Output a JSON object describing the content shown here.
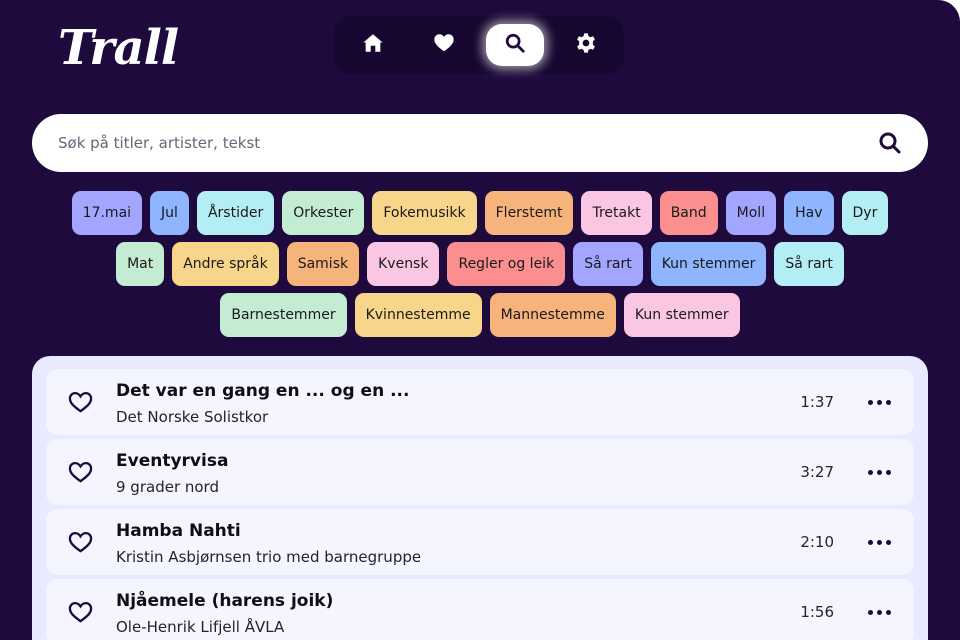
{
  "app": {
    "logo": "Trall"
  },
  "nav": {
    "items": [
      {
        "name": "home",
        "icon": "home-icon",
        "active": false
      },
      {
        "name": "favorites",
        "icon": "heart-icon",
        "active": false
      },
      {
        "name": "search",
        "icon": "search-icon",
        "active": true
      },
      {
        "name": "settings",
        "icon": "gear-icon",
        "active": false
      }
    ]
  },
  "search": {
    "placeholder": "Søk på titler, artister, tekst",
    "value": ""
  },
  "tags": {
    "row1": [
      {
        "label": "17.mai",
        "color": "#a3a6ff"
      },
      {
        "label": "Jul",
        "color": "#8fb5ff"
      },
      {
        "label": "Årstider",
        "color": "#b4eef5"
      },
      {
        "label": "Orkester",
        "color": "#c4ecd2"
      },
      {
        "label": "Fokemusikk",
        "color": "#f7d58a"
      },
      {
        "label": "Flerstemt",
        "color": "#f6b37c"
      },
      {
        "label": "Tretakt",
        "color": "#fbc6e4"
      },
      {
        "label": "Band",
        "color": "#fb8f8f"
      },
      {
        "label": "Moll",
        "color": "#a3a6ff"
      },
      {
        "label": "Hav",
        "color": "#8fb5ff"
      },
      {
        "label": "Dyr",
        "color": "#b4eef5"
      }
    ],
    "row2": [
      {
        "label": "Mat",
        "color": "#c4ecd2"
      },
      {
        "label": "Andre språk",
        "color": "#f7d58a"
      },
      {
        "label": "Samisk",
        "color": "#f6b37c"
      },
      {
        "label": "Kvensk",
        "color": "#fbc6e4"
      },
      {
        "label": "Regler og leik",
        "color": "#fb8f8f"
      },
      {
        "label": "Så rart",
        "color": "#a3a6ff"
      },
      {
        "label": "Kun stemmer",
        "color": "#8fb5ff"
      },
      {
        "label": "Så rart",
        "color": "#b4eef5"
      }
    ],
    "row3": [
      {
        "label": "Barnestemmer",
        "color": "#c4ecd2"
      },
      {
        "label": "Kvinnestemme",
        "color": "#f7d58a"
      },
      {
        "label": "Mannestemme",
        "color": "#f6b37c"
      },
      {
        "label": "Kun stemmer",
        "color": "#fbc6e4"
      }
    ]
  },
  "songs": [
    {
      "title": "Det var en gang en ... og en ...",
      "artist": "Det Norske Solistkor",
      "duration": "1:37"
    },
    {
      "title": "Eventyrvisa",
      "artist": "9 grader nord",
      "duration": "3:27"
    },
    {
      "title": "Hamba Nahti",
      "artist": "Kristin Asbjørnsen trio med barnegruppe",
      "duration": "2:10"
    },
    {
      "title": "Njåemele (harens joik)",
      "artist": "Ole-Henrik Lifjell ÅVLA",
      "duration": "1:56"
    }
  ],
  "colors": {
    "background": "#1f0a3d",
    "nav_bg": "#160630",
    "list_bg": "#e9eaff",
    "row_bg": "#f5f5ff"
  }
}
